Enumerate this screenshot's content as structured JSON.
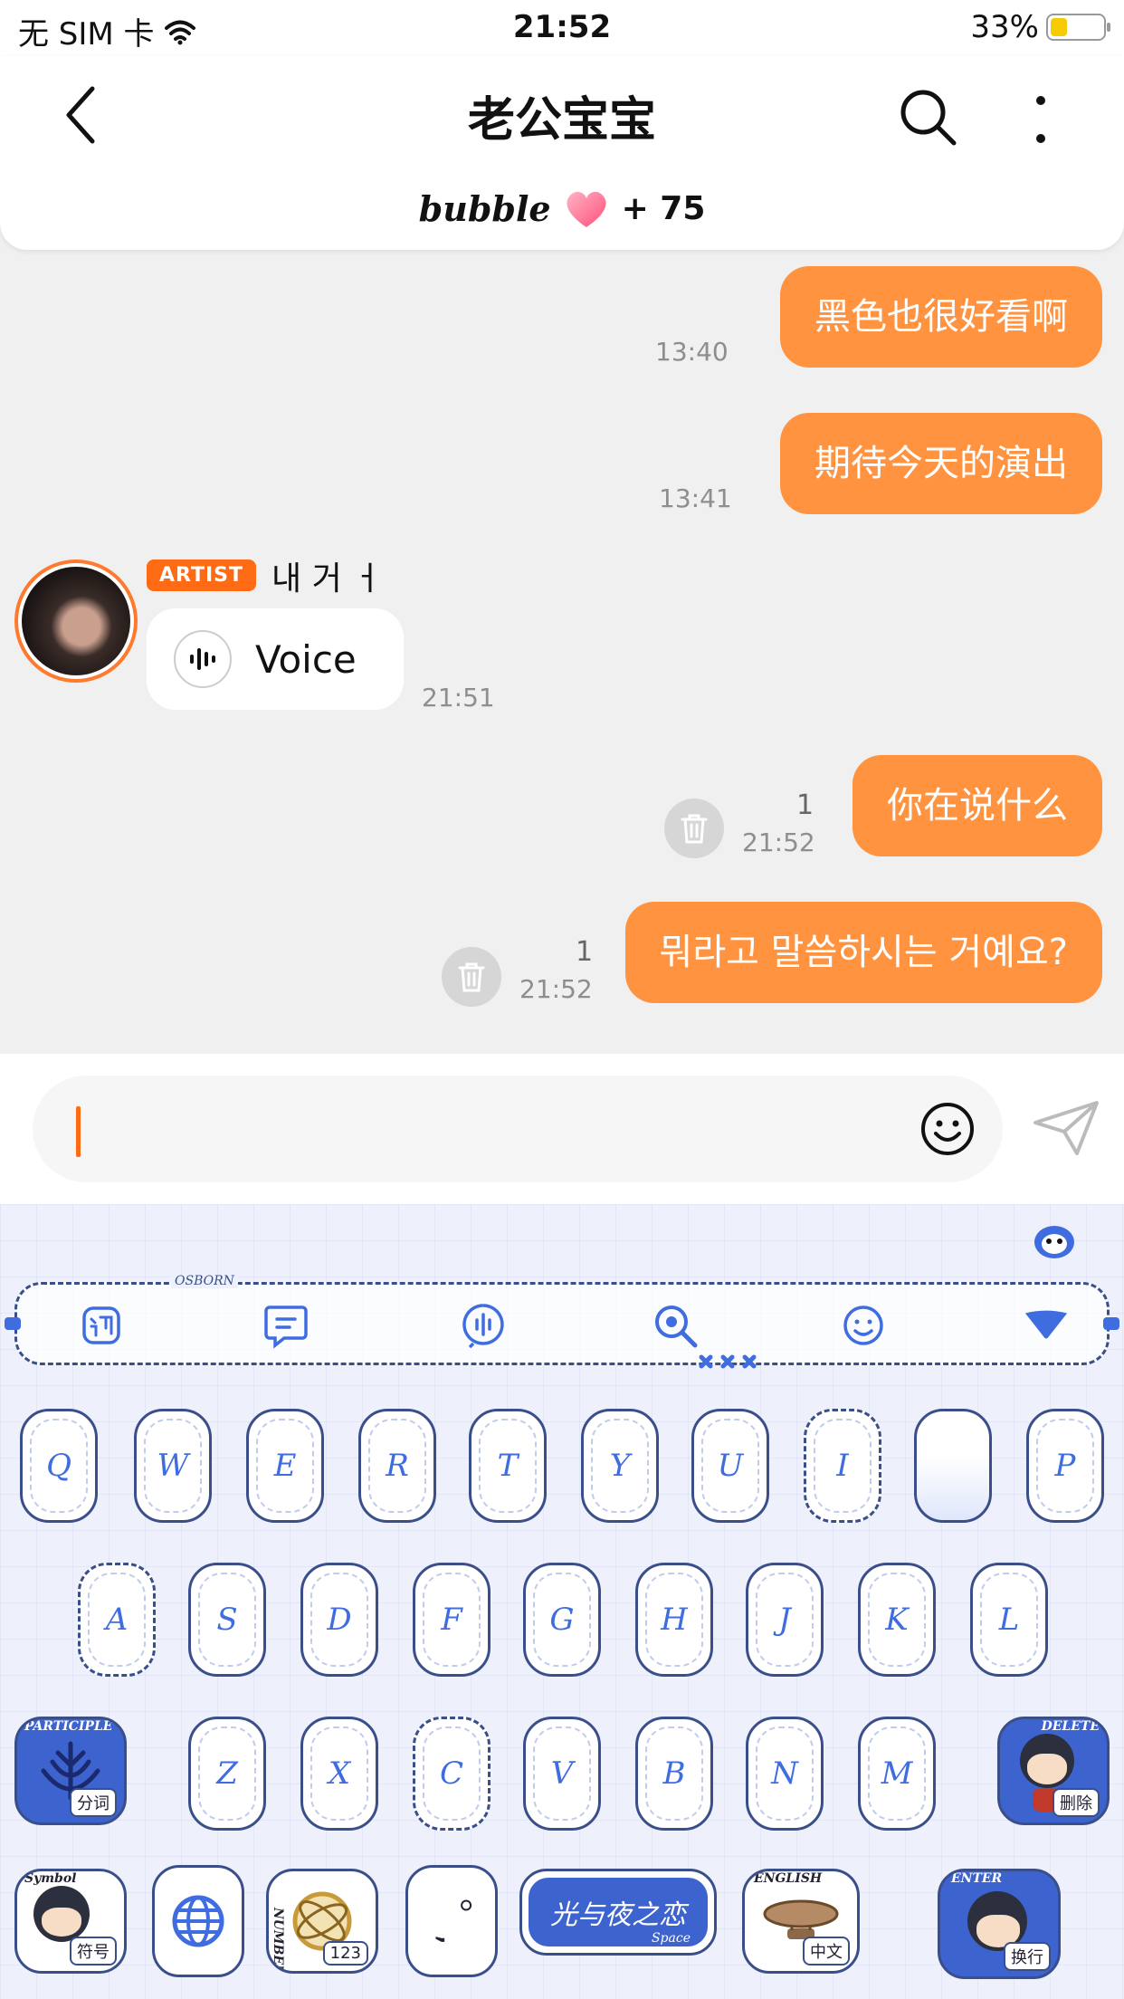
{
  "status_bar": {
    "carrier": "无 SIM 卡",
    "time": "21:52",
    "battery_percent": "33%",
    "battery_level": 0.33,
    "icons": [
      "wifi-icon",
      "battery-icon"
    ]
  },
  "header": {
    "title": "老公宝宝",
    "bubble_brand": "bubble",
    "bubble_count": "+ 75",
    "icons": [
      "back-icon",
      "search-icon",
      "more-icon",
      "heart-icon"
    ]
  },
  "messages": [
    {
      "side": "out",
      "text": "黑色也很好看啊",
      "time": "13:40"
    },
    {
      "side": "out",
      "text": "期待今天的演出",
      "time": "13:41"
    },
    {
      "side": "in",
      "badge": "ARTIST",
      "sender": "내 거 ㅓ",
      "text": "Voice",
      "time": "21:51"
    },
    {
      "side": "out",
      "text": "你在说什么",
      "time": "21:52",
      "unread": "1"
    },
    {
      "side": "out",
      "text": "뭐라고 말씀하시는 거예요?",
      "time": "21:52",
      "unread": "1"
    }
  ],
  "input": {
    "value": "",
    "icons": [
      "emoji-icon",
      "send-icon"
    ]
  },
  "keyboard": {
    "toolbar_tag": "OSBORN",
    "toolbar_icons": [
      "xun-icon",
      "chat-bubble-icon",
      "voice-input-icon",
      "search-icon",
      "emoji-icon",
      "collapse-icon"
    ],
    "row1": [
      "Q",
      "W",
      "E",
      "R",
      "T",
      "Y",
      "U",
      "I",
      "",
      "P"
    ],
    "row2": [
      "A",
      "S",
      "D",
      "F",
      "G",
      "H",
      "J",
      "K",
      "L"
    ],
    "row3": [
      "Z",
      "X",
      "C",
      "V",
      "B",
      "N",
      "M"
    ],
    "participle": {
      "tag": "PARTICIPLE",
      "label": "分词"
    },
    "delete": {
      "tag": "DELETE",
      "label": "删除"
    },
    "symbol": {
      "tag": "Symbol",
      "label": "符号"
    },
    "number": {
      "tag": "NUMBER",
      "label": "123"
    },
    "punct": "。,",
    "space": {
      "label": "光与夜之恋",
      "sub": "Space"
    },
    "english": {
      "tag": "ENGLISH",
      "label": "中文"
    },
    "enter": {
      "tag": "ENTER",
      "label": "换行"
    },
    "colors": {
      "accent": "#3f6de0",
      "outline": "#3a4f8a",
      "bubble_out": "#ff9340",
      "artist_badge": "#ff6a14"
    }
  }
}
